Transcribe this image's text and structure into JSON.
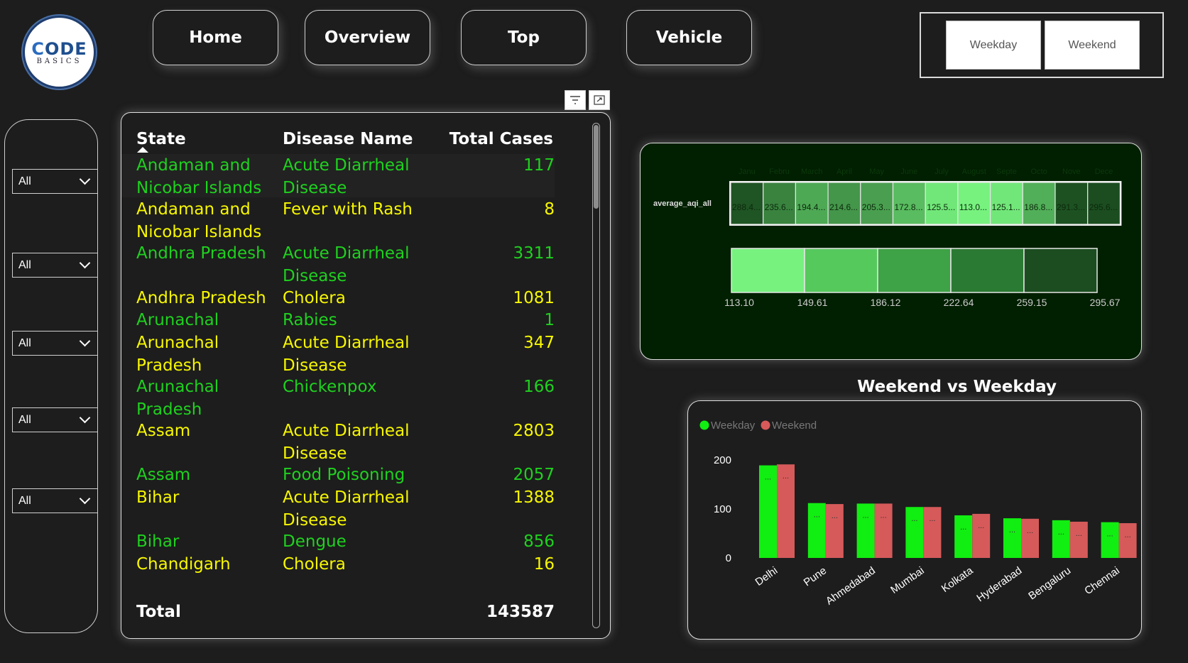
{
  "logo": {
    "line1": "ODE",
    "line1_prefix": "C",
    "line2": "BASICS"
  },
  "nav": {
    "home": "Home",
    "overview": "Overview",
    "top": "Top",
    "vehicle": "Vehicle"
  },
  "day_toggle": {
    "weekday": "Weekday",
    "weekend": "Weekend"
  },
  "slicers": [
    "All",
    "All",
    "All",
    "All",
    "All"
  ],
  "table": {
    "headers": {
      "state": "State",
      "disease": "Disease Name",
      "cases": "Total Cases"
    },
    "rows": [
      {
        "state": "Andaman and Nicobar Islands",
        "disease": "Acute Diarrheal Disease",
        "cases": "117"
      },
      {
        "state": "Andaman and Nicobar Islands",
        "disease": "Fever with Rash",
        "cases": "8"
      },
      {
        "state": "Andhra Pradesh",
        "disease": "Acute Diarrheal Disease",
        "cases": "3311"
      },
      {
        "state": "Andhra Pradesh",
        "disease": "Cholera",
        "cases": "1081"
      },
      {
        "state": "Arunachal",
        "disease": "Rabies",
        "cases": "1"
      },
      {
        "state": "Arunachal Pradesh",
        "disease": "Acute Diarrheal Disease",
        "cases": "347"
      },
      {
        "state": "Arunachal Pradesh",
        "disease": "Chickenpox",
        "cases": "166"
      },
      {
        "state": "Assam",
        "disease": "Acute Diarrheal Disease",
        "cases": "2803"
      },
      {
        "state": "Assam",
        "disease": "Food Poisoning",
        "cases": "2057"
      },
      {
        "state": "Bihar",
        "disease": "Acute Diarrheal Disease",
        "cases": "1388"
      },
      {
        "state": "Bihar",
        "disease": "Dengue",
        "cases": "856"
      },
      {
        "state": "Chandigarh",
        "disease": "Cholera",
        "cases": "16"
      }
    ],
    "total_label": "Total",
    "total_value": "143587"
  },
  "heatmap": {
    "row_label": "average_aqi_all",
    "months": [
      "Janu",
      "Febru",
      "March",
      "April",
      "May",
      "June",
      "July",
      "August",
      "Septe",
      "Octo",
      "Nove",
      "Dece"
    ],
    "cell_labels": [
      "288.4...",
      "235.6...",
      "194.4...",
      "214.6...",
      "205.3...",
      "172.8...",
      "125.5...",
      "113.0...",
      "125.1...",
      "186.8...",
      "291.3...",
      "295.6..."
    ],
    "values": [
      288.4,
      235.6,
      194.4,
      214.6,
      205.3,
      172.8,
      125.5,
      113.0,
      125.1,
      186.8,
      291.3,
      295.6
    ],
    "scale_ticks": [
      "113.10",
      "149.61",
      "186.12",
      "222.64",
      "259.15",
      "295.67"
    ],
    "scale_colors": [
      "#77f27f",
      "#56c95d",
      "#3ea246",
      "#2b7a33",
      "#1b4d20"
    ]
  },
  "chart_title": "Weekend vs Weekday",
  "chart_data": {
    "type": "bar",
    "categories": [
      "Delhi",
      "Pune",
      "Ahmedabad",
      "Mumbai",
      "Kolkata",
      "Hyderabad",
      "Bengaluru",
      "Chennai"
    ],
    "series": [
      {
        "name": "Weekday",
        "color": "#11ee11",
        "values": [
          189,
          112,
          111,
          104,
          87,
          81,
          77,
          73
        ]
      },
      {
        "name": "Weekend",
        "color": "#d65a5a",
        "values": [
          191,
          110,
          111,
          104,
          90,
          80,
          74,
          71
        ]
      }
    ],
    "yticks": [
      "0",
      "100",
      "200"
    ],
    "ylim": [
      0,
      200
    ],
    "data_label": "...",
    "legend_position": "top-left"
  }
}
